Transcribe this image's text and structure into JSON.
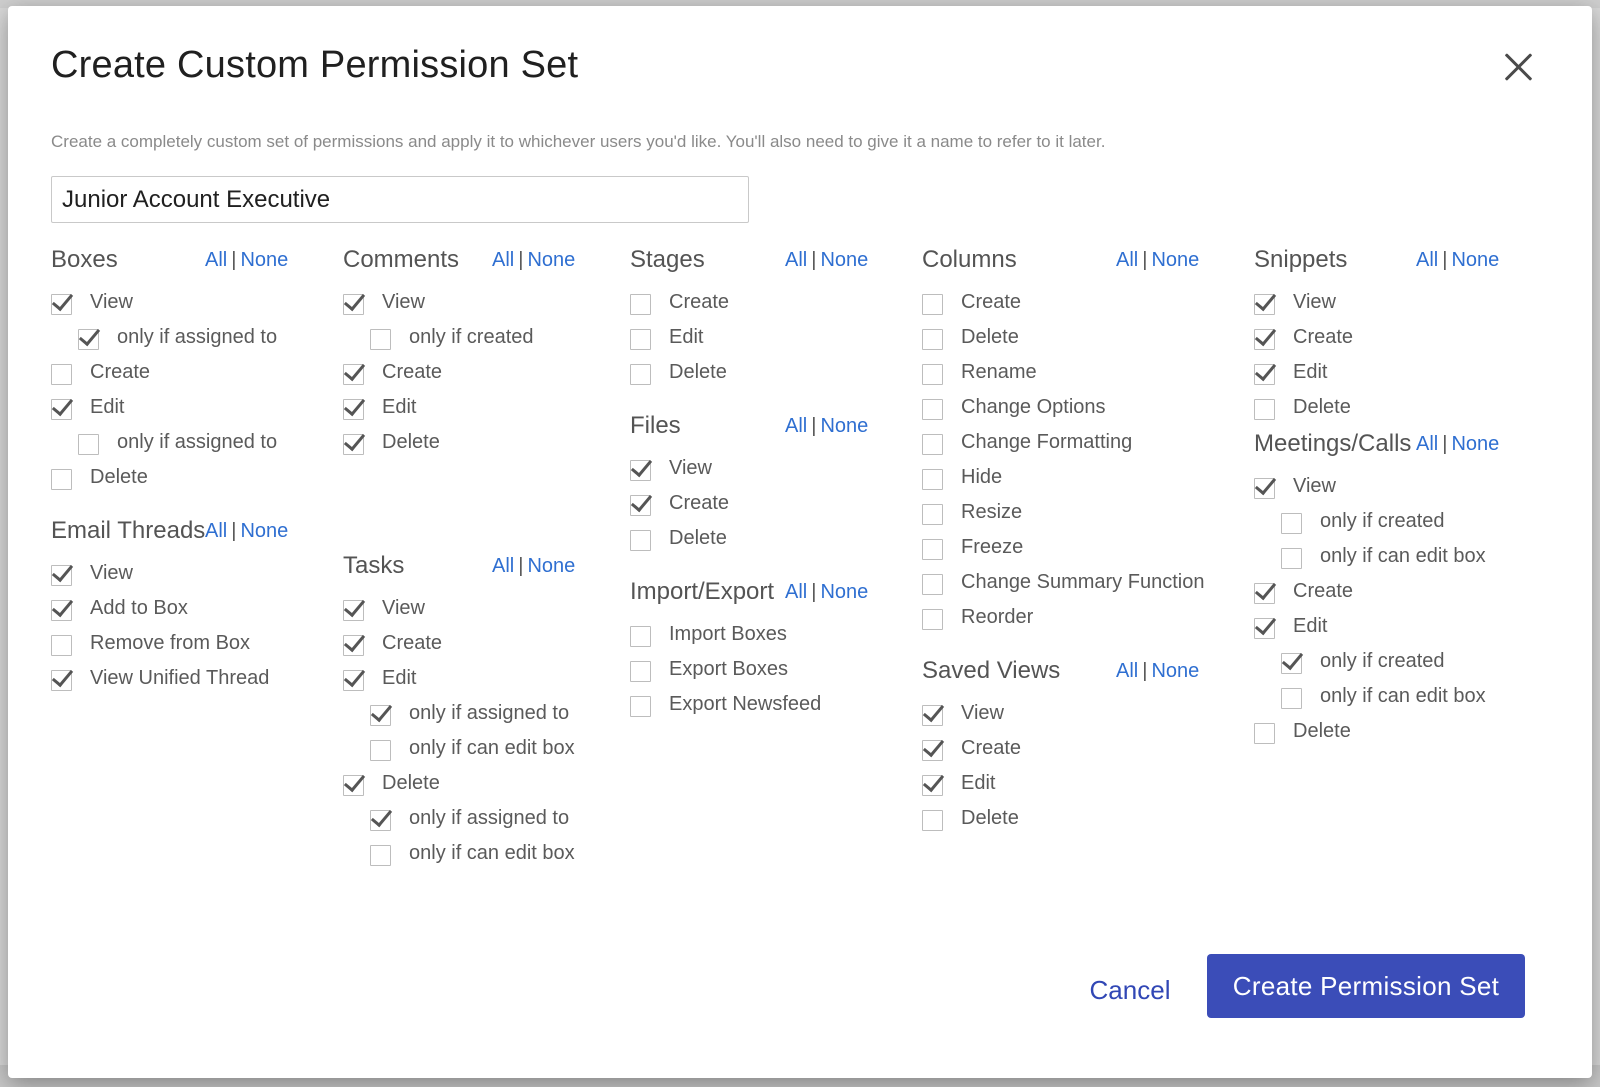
{
  "modal": {
    "title": "Create Custom Permission Set",
    "description": "Create a completely custom set of permissions and apply it to whichever users you'd like. You'll also need to give it a name to refer to it later.",
    "name_value": "Junior Account Executive"
  },
  "all_label": "All",
  "none_label": "None",
  "sep_label": "|",
  "sections": {
    "boxes": {
      "title": "Boxes",
      "items": [
        {
          "label": "View",
          "checked": true,
          "sub": false
        },
        {
          "label": "only if assigned to",
          "checked": true,
          "sub": true
        },
        {
          "label": "Create",
          "checked": false,
          "sub": false
        },
        {
          "label": "Edit",
          "checked": true,
          "sub": false
        },
        {
          "label": "only if assigned to",
          "checked": false,
          "sub": true
        },
        {
          "label": "Delete",
          "checked": false,
          "sub": false
        }
      ]
    },
    "email_threads": {
      "title": "Email Threads",
      "items": [
        {
          "label": "View",
          "checked": true,
          "sub": false
        },
        {
          "label": "Add to Box",
          "checked": true,
          "sub": false
        },
        {
          "label": "Remove from Box",
          "checked": false,
          "sub": false
        },
        {
          "label": "View Unified Thread",
          "checked": true,
          "sub": false
        }
      ]
    },
    "comments": {
      "title": "Comments",
      "items": [
        {
          "label": "View",
          "checked": true,
          "sub": false
        },
        {
          "label": "only if created",
          "checked": false,
          "sub": true
        },
        {
          "label": "Create",
          "checked": true,
          "sub": false
        },
        {
          "label": "Edit",
          "checked": true,
          "sub": false
        },
        {
          "label": "Delete",
          "checked": true,
          "sub": false
        }
      ]
    },
    "tasks": {
      "title": "Tasks",
      "items": [
        {
          "label": "View",
          "checked": true,
          "sub": false
        },
        {
          "label": "Create",
          "checked": true,
          "sub": false
        },
        {
          "label": "Edit",
          "checked": true,
          "sub": false
        },
        {
          "label": "only if assigned to",
          "checked": true,
          "sub": true
        },
        {
          "label": "only if can edit box",
          "checked": false,
          "sub": true
        },
        {
          "label": "Delete",
          "checked": true,
          "sub": false
        },
        {
          "label": "only if assigned to",
          "checked": true,
          "sub": true
        },
        {
          "label": "only if can edit box",
          "checked": false,
          "sub": true
        }
      ]
    },
    "stages": {
      "title": "Stages",
      "items": [
        {
          "label": "Create",
          "checked": false,
          "sub": false
        },
        {
          "label": "Edit",
          "checked": false,
          "sub": false
        },
        {
          "label": "Delete",
          "checked": false,
          "sub": false
        }
      ]
    },
    "files": {
      "title": "Files",
      "items": [
        {
          "label": "View",
          "checked": true,
          "sub": false
        },
        {
          "label": "Create",
          "checked": true,
          "sub": false
        },
        {
          "label": "Delete",
          "checked": false,
          "sub": false
        }
      ]
    },
    "import_export": {
      "title": "Import/Export",
      "items": [
        {
          "label": "Import Boxes",
          "checked": false,
          "sub": false
        },
        {
          "label": "Export Boxes",
          "checked": false,
          "sub": false
        },
        {
          "label": "Export Newsfeed",
          "checked": false,
          "sub": false
        }
      ]
    },
    "columns": {
      "title": "Columns",
      "items": [
        {
          "label": "Create",
          "checked": false,
          "sub": false
        },
        {
          "label": "Delete",
          "checked": false,
          "sub": false
        },
        {
          "label": "Rename",
          "checked": false,
          "sub": false
        },
        {
          "label": "Change Options",
          "checked": false,
          "sub": false
        },
        {
          "label": "Change Formatting",
          "checked": false,
          "sub": false
        },
        {
          "label": "Hide",
          "checked": false,
          "sub": false
        },
        {
          "label": "Resize",
          "checked": false,
          "sub": false
        },
        {
          "label": "Freeze",
          "checked": false,
          "sub": false
        },
        {
          "label": "Change Summary Function",
          "checked": false,
          "sub": false
        },
        {
          "label": "Reorder",
          "checked": false,
          "sub": false
        }
      ]
    },
    "saved_views": {
      "title": "Saved Views",
      "items": [
        {
          "label": "View",
          "checked": true,
          "sub": false
        },
        {
          "label": "Create",
          "checked": true,
          "sub": false
        },
        {
          "label": "Edit",
          "checked": true,
          "sub": false
        },
        {
          "label": "Delete",
          "checked": false,
          "sub": false
        }
      ]
    },
    "snippets": {
      "title": "Snippets",
      "items": [
        {
          "label": "View",
          "checked": true,
          "sub": false
        },
        {
          "label": "Create",
          "checked": true,
          "sub": false
        },
        {
          "label": "Edit",
          "checked": true,
          "sub": false
        },
        {
          "label": "Delete",
          "checked": false,
          "sub": false
        }
      ]
    },
    "meetings_calls": {
      "title": "Meetings/Calls",
      "items": [
        {
          "label": "View",
          "checked": true,
          "sub": false
        },
        {
          "label": "only if created",
          "checked": false,
          "sub": true
        },
        {
          "label": "only if can edit box",
          "checked": false,
          "sub": true
        },
        {
          "label": "Create",
          "checked": true,
          "sub": false
        },
        {
          "label": "Edit",
          "checked": true,
          "sub": false
        },
        {
          "label": "only if created",
          "checked": true,
          "sub": true
        },
        {
          "label": "only if can edit box",
          "checked": false,
          "sub": true
        },
        {
          "label": "Delete",
          "checked": false,
          "sub": false
        }
      ]
    }
  },
  "footer": {
    "cancel_label": "Cancel",
    "create_label": "Create Permission Set"
  },
  "colors": {
    "link": "#2f6fd1",
    "primary_button": "#3b4db8",
    "cancel_text": "#3147b5"
  }
}
